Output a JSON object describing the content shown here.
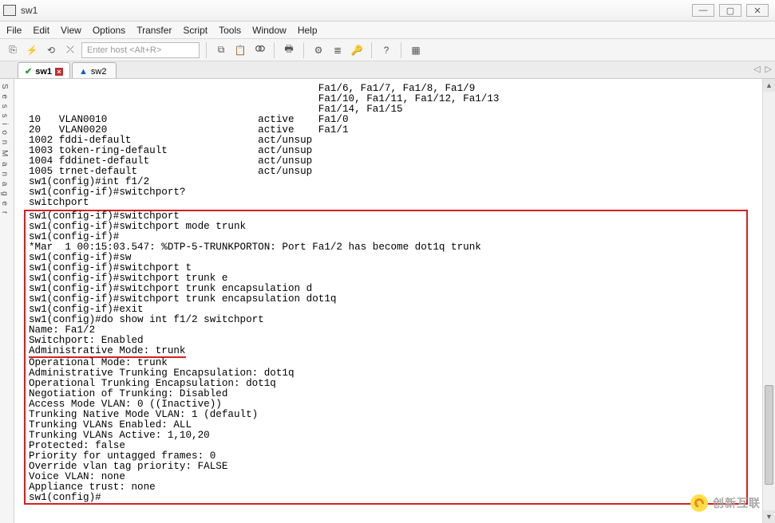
{
  "window": {
    "title": "sw1",
    "min": "—",
    "max": "▢",
    "close": "✕"
  },
  "menu": {
    "file": "File",
    "edit": "Edit",
    "view": "View",
    "options": "Options",
    "transfer": "Transfer",
    "script": "Script",
    "tools": "Tools",
    "window": "Window",
    "help": "Help"
  },
  "toolbar": {
    "host_placeholder": "Enter host <Alt+R>"
  },
  "tabs": {
    "tab1": {
      "label": "sw1",
      "status": "✔"
    },
    "tab2": {
      "label": "sw2",
      "status": "▲"
    },
    "nav_left": "◁",
    "nav_right": "▷"
  },
  "sidebar": {
    "label": "S e s s i o n   M a n a g e r"
  },
  "term": {
    "pre": "                                                Fa1/6, Fa1/7, Fa1/8, Fa1/9\n                                                Fa1/10, Fa1/11, Fa1/12, Fa1/13\n                                                Fa1/14, Fa1/15\n10   VLAN0010                         active    Fa1/0\n20   VLAN0020                         active    Fa1/1\n1002 fddi-default                     act/unsup\n1003 token-ring-default               act/unsup\n1004 fddinet-default                  act/unsup\n1005 trnet-default                    act/unsup\nsw1(config)#int f1/2\nsw1(config-if)#switchport?\nswitchport",
    "box1": "sw1(config-if)#switchport\nsw1(config-if)#switchport mode trunk\nsw1(config-if)#\n*Mar  1 00:15:03.547: %DTP-5-TRUNKPORTON: Port Fa1/2 has become dot1q trunk\nsw1(config-if)#sw\nsw1(config-if)#switchport t\nsw1(config-if)#switchport trunk e\nsw1(config-if)#switchport trunk encapsulation d\nsw1(config-if)#switchport trunk encapsulation dot1q\nsw1(config-if)#exit\nsw1(config)#do show int f1/2 switchport\nName: Fa1/2\nSwitchport: Enabled",
    "box1_under": "Administrative Mode: trunk",
    "box2": "Operational Mode: trunk\nAdministrative Trunking Encapsulation: dot1q\nOperational Trunking Encapsulation: dot1q\nNegotiation of Trunking: Disabled\nAccess Mode VLAN: 0 ((Inactive))\nTrunking Native Mode VLAN: 1 (default)\nTrunking VLANs Enabled: ALL\nTrunking VLANs Active: 1,10,20\nProtected: false\nPriority for untagged frames: 0\nOverride vlan tag priority: FALSE\nVoice VLAN: none\nAppliance trust: none\nsw1(config)#"
  },
  "watermark": {
    "text": "创新互联"
  }
}
